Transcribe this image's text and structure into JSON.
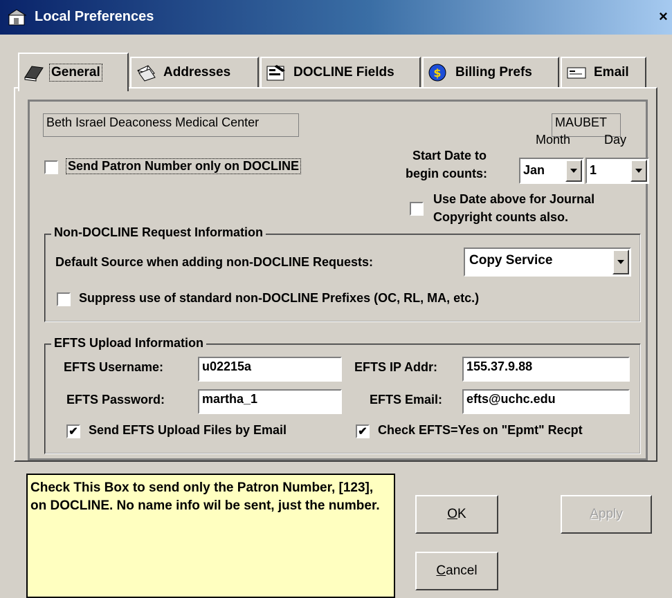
{
  "window": {
    "title": "Local Preferences",
    "close": "×"
  },
  "tabs": [
    {
      "label": "General",
      "icon": "book-icon"
    },
    {
      "label": "Addresses",
      "icon": "envelopes-icon"
    },
    {
      "label": "DOCLINE Fields",
      "icon": "form-icon"
    },
    {
      "label": "Billing Prefs",
      "icon": "dollar-icon"
    },
    {
      "label": "Email",
      "icon": "email-card-icon"
    }
  ],
  "general": {
    "institution_name": "Beth Israel Deaconess Medical Center",
    "library_id": "MAUBET",
    "send_patron_label": "Send Patron Number only on DOCLINE",
    "send_patron_checked": false,
    "month_label": "Month",
    "day_label": "Day",
    "start_date_label_1": "Start Date to",
    "start_date_label_2": "begin counts:",
    "month_value": "Jan",
    "day_value": "1",
    "use_date_label_1": "Use Date above for Journal",
    "use_date_label_2": "Copyright counts also.",
    "use_date_checked": false
  },
  "non_docline": {
    "legend": "Non-DOCLINE Request Information",
    "default_source_label": "Default Source when adding non-DOCLINE Requests:",
    "default_source_value": "Copy Service",
    "suppress_label": "Suppress use of standard non-DOCLINE Prefixes (OC, RL, MA, etc.)",
    "suppress_checked": false
  },
  "efts": {
    "legend": "EFTS Upload Information",
    "username_label": "EFTS Username:",
    "username_value": "u02215a",
    "ip_label": "EFTS IP Addr:",
    "ip_value": "155.37.9.88",
    "password_label": "EFTS Password:",
    "password_value": "martha_1",
    "email_label": "EFTS Email:",
    "email_value": "efts@uchc.edu",
    "send_by_email_label": "Send EFTS Upload Files by Email",
    "send_by_email_checked": true,
    "check_efts_label": "Check EFTS=Yes on \"Epmt\" Recpt",
    "check_efts_checked": true
  },
  "help_text": "Check This Box to send only the Patron Number, [123], on DOCLINE.  No name info wil be sent, just the number.",
  "buttons": {
    "ok": "OK",
    "apply": "Apply",
    "cancel": "Cancel"
  },
  "checkmark": "✔"
}
